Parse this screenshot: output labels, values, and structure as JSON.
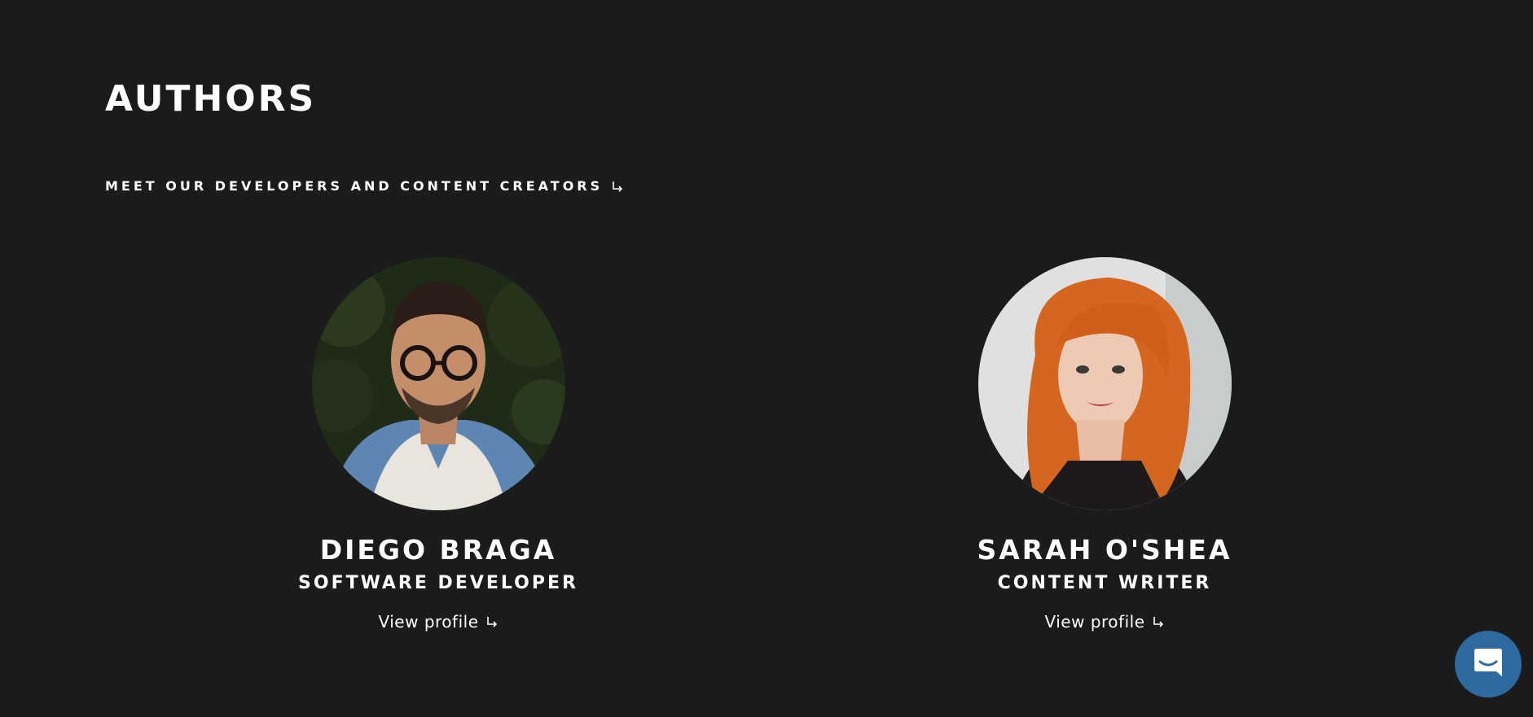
{
  "header": {
    "title": "AUTHORS",
    "subtitle": "MEET OUR DEVELOPERS AND CONTENT CREATORS"
  },
  "authors": [
    {
      "name": "DIEGO BRAGA",
      "role": "SOFTWARE DEVELOPER",
      "link_label": "View profile"
    },
    {
      "name": "SARAH O'SHEA",
      "role": "CONTENT WRITER",
      "link_label": "View profile"
    }
  ],
  "icons": {
    "subtitle_arrow": "arrow-down-right-icon",
    "link_arrow": "arrow-down-right-icon",
    "chat": "chat-icon"
  },
  "colors": {
    "background": "#1b1b1b",
    "text": "#ffffff",
    "chat_button": "#2d6aa0"
  }
}
